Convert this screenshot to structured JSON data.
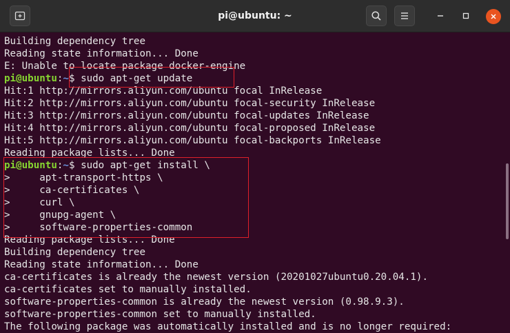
{
  "window": {
    "title": "pi@ubuntu: ~"
  },
  "prompt": {
    "user_host": "pi@ubuntu",
    "sep": ":",
    "path": "~",
    "symbol": "$ "
  },
  "lines": [
    {
      "kind": "out",
      "text": "Building dependency tree"
    },
    {
      "kind": "out",
      "text": "Reading state information... Done"
    },
    {
      "kind": "out",
      "text": "E: Unable to locate package docker-engine"
    },
    {
      "kind": "cmd",
      "text": "sudo apt-get update"
    },
    {
      "kind": "out",
      "text": "Hit:1 http://mirrors.aliyun.com/ubuntu focal InRelease"
    },
    {
      "kind": "out",
      "text": "Hit:2 http://mirrors.aliyun.com/ubuntu focal-security InRelease"
    },
    {
      "kind": "out",
      "text": "Hit:3 http://mirrors.aliyun.com/ubuntu focal-updates InRelease"
    },
    {
      "kind": "out",
      "text": "Hit:4 http://mirrors.aliyun.com/ubuntu focal-proposed InRelease"
    },
    {
      "kind": "out",
      "text": "Hit:5 http://mirrors.aliyun.com/ubuntu focal-backports InRelease"
    },
    {
      "kind": "out",
      "text": "Reading package lists... Done"
    },
    {
      "kind": "cmd",
      "text": "sudo apt-get install \\"
    },
    {
      "kind": "out",
      "text": ">     apt-transport-https \\"
    },
    {
      "kind": "out",
      "text": ">     ca-certificates \\"
    },
    {
      "kind": "out",
      "text": ">     curl \\"
    },
    {
      "kind": "out",
      "text": ">     gnupg-agent \\"
    },
    {
      "kind": "out",
      "text": ">     software-properties-common"
    },
    {
      "kind": "out",
      "text": "Reading package lists... Done"
    },
    {
      "kind": "out",
      "text": "Building dependency tree"
    },
    {
      "kind": "out",
      "text": "Reading state information... Done"
    },
    {
      "kind": "out",
      "text": "ca-certificates is already the newest version (20201027ubuntu0.20.04.1)."
    },
    {
      "kind": "out",
      "text": "ca-certificates set to manually installed."
    },
    {
      "kind": "out",
      "text": "software-properties-common is already the newest version (0.98.9.3)."
    },
    {
      "kind": "out",
      "text": "software-properties-common set to manually installed."
    },
    {
      "kind": "out",
      "text": "The following package was automatically installed and is no longer required:"
    }
  ],
  "colors": {
    "background": "#300a24",
    "prompt_user": "#87d631",
    "prompt_path": "#6a8fd8",
    "highlight": "#e0202a",
    "close": "#e95420"
  },
  "icons": {
    "new_tab": "new-tab-icon",
    "search": "search-icon",
    "menu": "hamburger-menu-icon",
    "minimize": "minimize-icon",
    "maximize": "maximize-icon",
    "close": "close-icon"
  }
}
